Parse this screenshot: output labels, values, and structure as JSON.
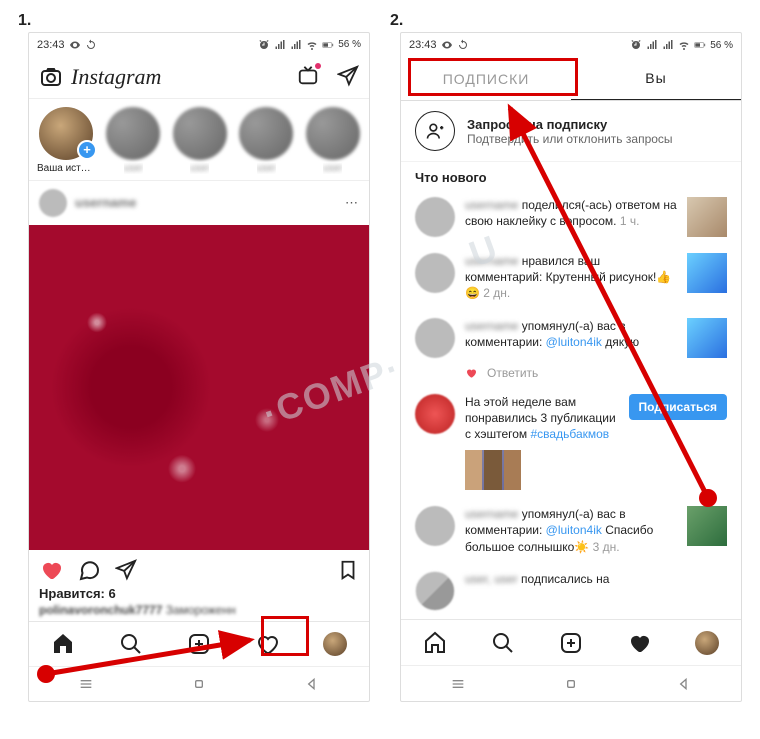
{
  "steps": {
    "one": "1.",
    "two": "2."
  },
  "statusbar": {
    "time": "23:43",
    "battery": "56 %"
  },
  "feed": {
    "brand": "Instagram",
    "stories": {
      "mine_label": "Ваша истор..."
    },
    "post": {
      "likes_label": "Нравится: 6",
      "caption_user": "polinavoronchuk7777",
      "caption_text": "Замороженн"
    }
  },
  "activity": {
    "tabs": {
      "following": "ПОДПИСКИ",
      "you": "Вы"
    },
    "follow_requests": {
      "title": "Запросы на подписку",
      "subtitle": "Подтвердить или отклонить запросы"
    },
    "section": "Что нового",
    "items": [
      {
        "action": "поделился(-ась) ответом на свою наклейку с вопросом.",
        "time": "1 ч."
      },
      {
        "action": "нравился ваш комментарий: Крутенный рисунок!👍😄",
        "time": "2 дн."
      },
      {
        "action": "упомянул(-а) вас в комментарии:",
        "mention": "@luiton4ik",
        "extra": "дякую"
      },
      {
        "reply_label": "Ответить"
      },
      {
        "suggest": "На этой неделе вам понравились 3 публикации с хэштегом",
        "hashtag": "#свадьбакмов",
        "button": "Подписаться"
      },
      {
        "action": "упомянул(-а) вас в комментарии:",
        "mention": "@luiton4ik",
        "extra": "Спасибо большое солнышко☀️",
        "time": "3 дн."
      },
      {
        "action": "подписались на"
      }
    ]
  }
}
